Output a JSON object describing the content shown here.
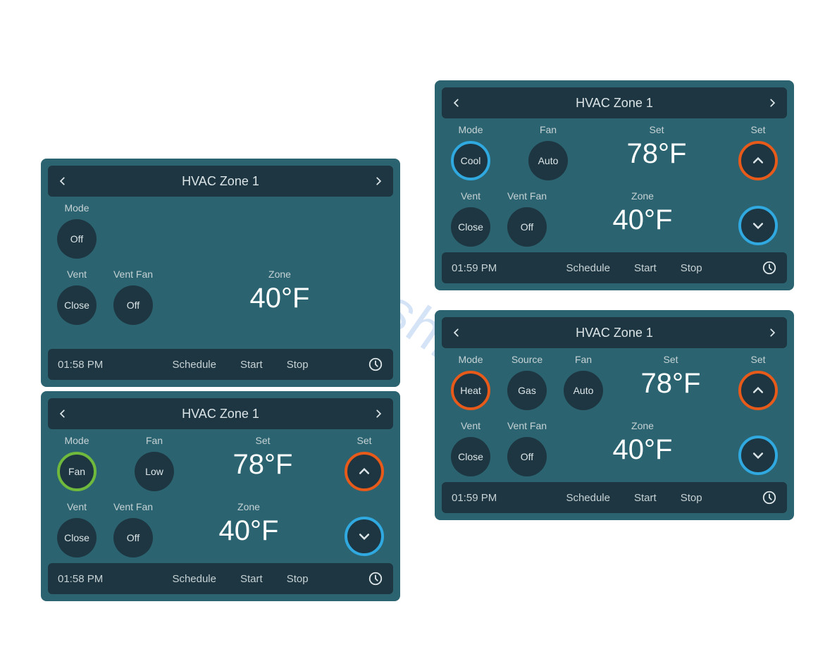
{
  "watermark": "manualshive.com",
  "footer": {
    "schedule": "Schedule",
    "start": "Start",
    "stop": "Stop"
  },
  "panels": {
    "p1": {
      "title": "HVAC Zone 1",
      "mode_label": "Mode",
      "mode_value": "Off",
      "vent_label": "Vent",
      "vent_value": "Close",
      "ventfan_label": "Vent Fan",
      "ventfan_value": "Off",
      "zone_label": "Zone",
      "zone_value": "40°F",
      "time": "01:58 PM"
    },
    "p2": {
      "title": "HVAC Zone 1",
      "mode_label": "Mode",
      "mode_value": "Fan",
      "fan_label": "Fan",
      "fan_value": "Low",
      "set_label": "Set",
      "set_value": "78°F",
      "set2_label": "Set",
      "vent_label": "Vent",
      "vent_value": "Close",
      "ventfan_label": "Vent Fan",
      "ventfan_value": "Off",
      "zone_label": "Zone",
      "zone_value": "40°F",
      "time": "01:58 PM"
    },
    "p3": {
      "title": "HVAC Zone 1",
      "mode_label": "Mode",
      "mode_value": "Cool",
      "fan_label": "Fan",
      "fan_value": "Auto",
      "set_label": "Set",
      "set_value": "78°F",
      "set2_label": "Set",
      "vent_label": "Vent",
      "vent_value": "Close",
      "ventfan_label": "Vent Fan",
      "ventfan_value": "Off",
      "zone_label": "Zone",
      "zone_value": "40°F",
      "time": "01:59 PM"
    },
    "p4": {
      "title": "HVAC Zone 1",
      "mode_label": "Mode",
      "mode_value": "Heat",
      "source_label": "Source",
      "source_value": "Gas",
      "fan_label": "Fan",
      "fan_value": "Auto",
      "set_label": "Set",
      "set_value": "78°F",
      "set2_label": "Set",
      "vent_label": "Vent",
      "vent_value": "Close",
      "ventfan_label": "Vent Fan",
      "ventfan_value": "Off",
      "zone_label": "Zone",
      "zone_value": "40°F",
      "time": "01:59 PM"
    }
  }
}
